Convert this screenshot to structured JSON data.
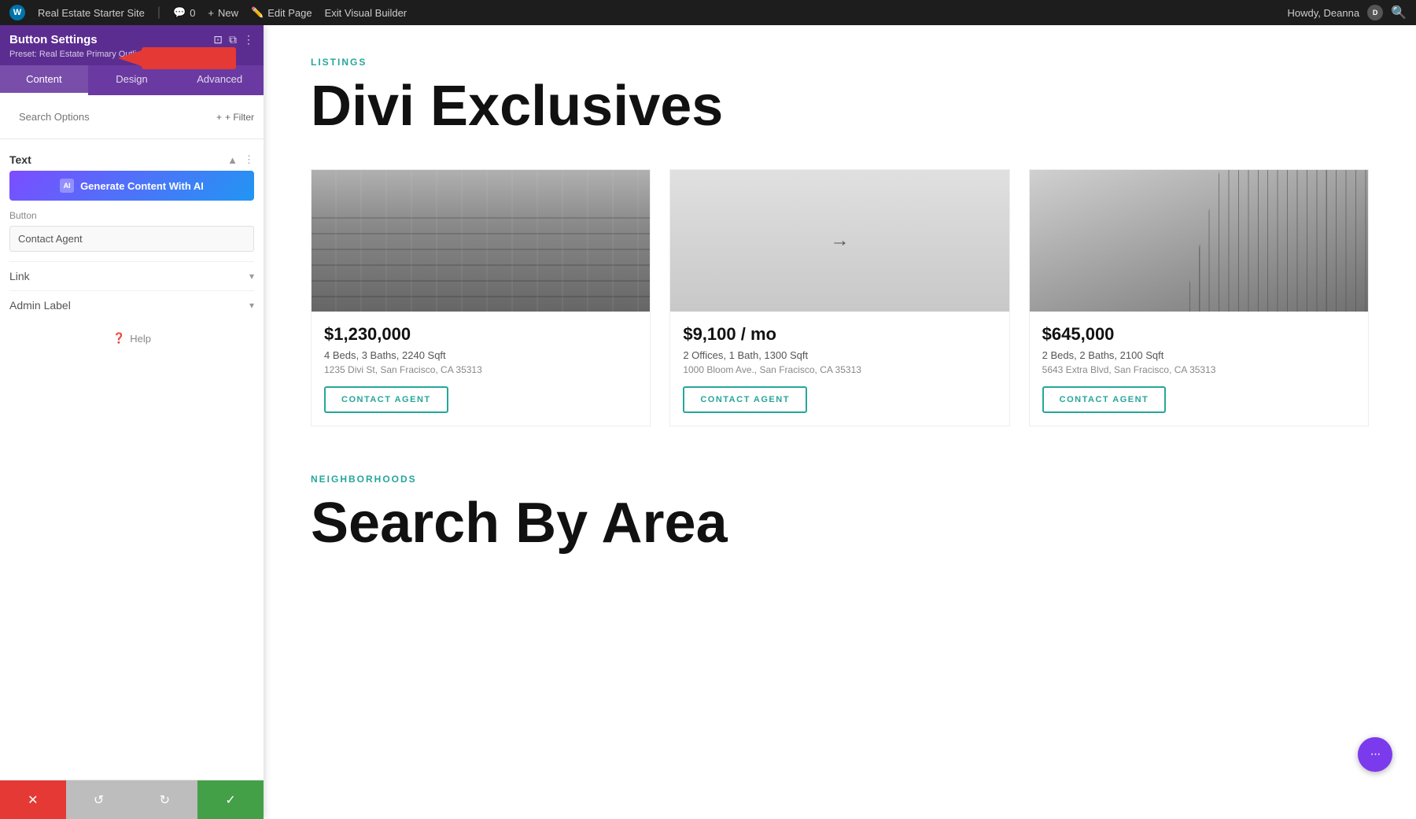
{
  "adminBar": {
    "wpIcon": "W",
    "siteName": "Real Estate Starter Site",
    "commentsCount": "0",
    "newLabel": "New",
    "editPageLabel": "Edit Page",
    "exitBuilderLabel": "Exit Visual Builder",
    "howdy": "Howdy, Deanna",
    "searchIcon": "🔍"
  },
  "panel": {
    "title": "Button Settings",
    "presetLabel": "Preset: Real Estate Primary Outline Small",
    "tabs": [
      "Content",
      "Design",
      "Advanced"
    ],
    "activeTab": "Content",
    "searchPlaceholder": "Search Options",
    "filterLabel": "+ Filter",
    "textSection": {
      "title": "Text",
      "aiButtonLabel": "Generate Content With AI",
      "aiIcon": "AI"
    },
    "buttonSection": {
      "title": "Button",
      "inputValue": "Contact Agent"
    },
    "linkSection": {
      "title": "Link"
    },
    "adminLabelSection": {
      "title": "Admin Label"
    },
    "helpLabel": "Help"
  },
  "bottomToolbar": {
    "closeIcon": "✕",
    "undoIcon": "↺",
    "redoIcon": "↻",
    "saveIcon": "✓"
  },
  "content": {
    "listingsSectionLabel": "LISTINGS",
    "mainTitle": "Divi Exclusives",
    "listings": [
      {
        "price": "$1,230,000",
        "details": "4 Beds, 3 Baths, 2240 Sqft",
        "address": "1235 Divi St, San Fracisco, CA 35313",
        "contactLabel": "CONTACT AGENT",
        "imageType": "building-1"
      },
      {
        "price": "$9,100 / mo",
        "details": "2 Offices, 1 Bath, 1300 Sqft",
        "address": "1000 Bloom Ave., San Fracisco, CA 35313",
        "contactLabel": "CONTACT AGENT",
        "imageType": "building-2",
        "imageSymbol": "→"
      },
      {
        "price": "$645,000",
        "details": "2 Beds, 2 Baths, 2100 Sqft",
        "address": "5643 Extra Blvd, San Fracisco, CA 35313",
        "contactLabel": "CONTACT AGENT",
        "imageType": "building-3"
      }
    ],
    "neighborhoodsSectionLabel": "NEIGHBORHOODS",
    "neighborhoodsTitle": "Search By Area"
  },
  "floatingBtn": {
    "icon": "···"
  }
}
